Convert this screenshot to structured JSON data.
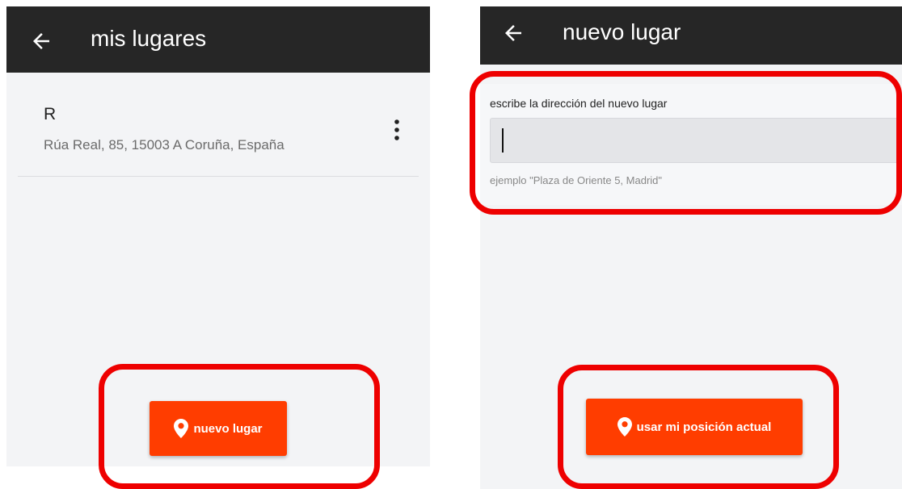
{
  "left_screen": {
    "title": "mis lugares",
    "back_icon": "arrow-left-icon",
    "places": [
      {
        "name": "R",
        "address": "Rúa Real, 85, 15003 A Coruña, España",
        "menu_icon": "more-vertical-icon"
      }
    ],
    "new_place_button": {
      "label": "nuevo lugar",
      "icon": "location-pin-icon"
    }
  },
  "right_screen": {
    "title": "nuevo lugar",
    "back_icon": "arrow-left-icon",
    "address_field": {
      "label": "escribe la dirección del nuevo lugar",
      "value": "",
      "hint": "ejemplo \"Plaza de Oriente 5, Madrid\""
    },
    "current_position_button": {
      "label": "usar mi posición actual",
      "icon": "location-pin-icon"
    }
  },
  "colors": {
    "app_bar": "#262626",
    "accent": "#ff3d00",
    "highlight": "#ee0000",
    "background": "#f3f4f6"
  }
}
